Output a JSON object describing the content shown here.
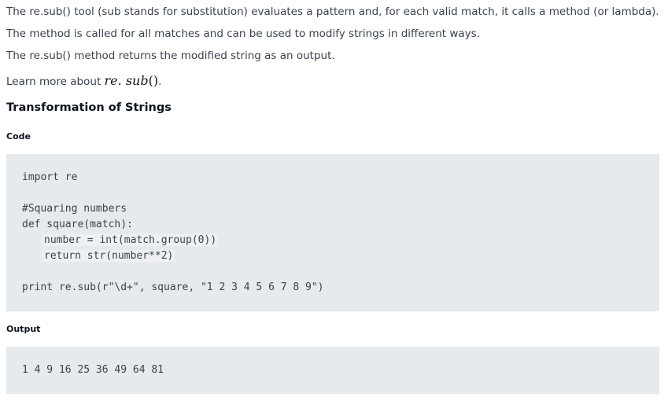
{
  "description": {
    "para1": "The re.sub() tool (sub stands for substitution) evaluates a pattern and, for each valid match, it calls a method (or lambda).",
    "para2": "The method is called for all matches and can be used to modify strings in different ways.",
    "para3": "The re.sub() method returns the modified string as an output.",
    "learn_more_prefix": "Learn more about ",
    "learn_more_math_main": "re. sub",
    "learn_more_math_parens": "()",
    "learn_more_suffix": "."
  },
  "section": {
    "title": "Transformation of Strings"
  },
  "code_block": {
    "label": "Code",
    "lines": {
      "l1": "import re",
      "l2": "",
      "l3": "#Squaring numbers",
      "l4": "def square(match):",
      "l5": "number = int(match.group(0))",
      "l6": "return str(number**2)",
      "l7": "",
      "l8": "print re.sub(r\"\\d+\", square, \"1 2 3 4 5 6 7 8 9\")"
    }
  },
  "output_block": {
    "label": "Output",
    "text": "1 4 9 16 25 36 49 64 81"
  }
}
